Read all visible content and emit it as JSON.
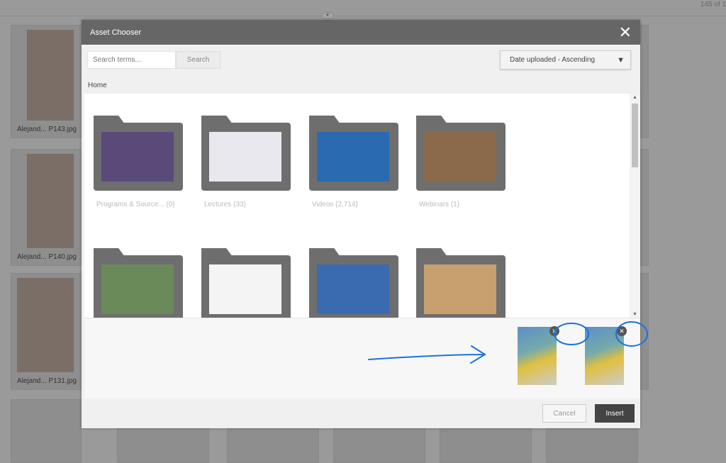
{
  "background": {
    "count": "145 of 1",
    "tiles": [
      {
        "label": "Alejand... P143.jpg"
      },
      {
        "label": "Alejand... P140.jpg"
      },
      {
        "label": "Alejand... P131.jpg"
      }
    ]
  },
  "modal": {
    "title": "Asset Chooser",
    "close_icon": "close-icon",
    "search": {
      "placeholder": "Search terms...",
      "button": "Search"
    },
    "sort": {
      "selected": "Date uploaded - Ascending"
    },
    "breadcrumb": "Home",
    "folders": [
      {
        "label": "Programs & Source...  (0)",
        "color": "#5a4a7a"
      },
      {
        "label": "Lectures (33)",
        "color": "#e8e8ee"
      },
      {
        "label": "Videos (2,714)",
        "color": "#2a6ab0"
      },
      {
        "label": "Webinars (1)",
        "color": "#8a6a4a"
      },
      {
        "label": "",
        "color": "#6a8a5a"
      },
      {
        "label": "",
        "color": "#f4f4f4"
      },
      {
        "label": "",
        "color": "#3a6ab0"
      },
      {
        "label": "",
        "color": "#c8a070"
      }
    ],
    "selected_count": 2,
    "cancel": "Cancel",
    "insert": "Insert"
  },
  "annotation_color": "#1a73d9"
}
